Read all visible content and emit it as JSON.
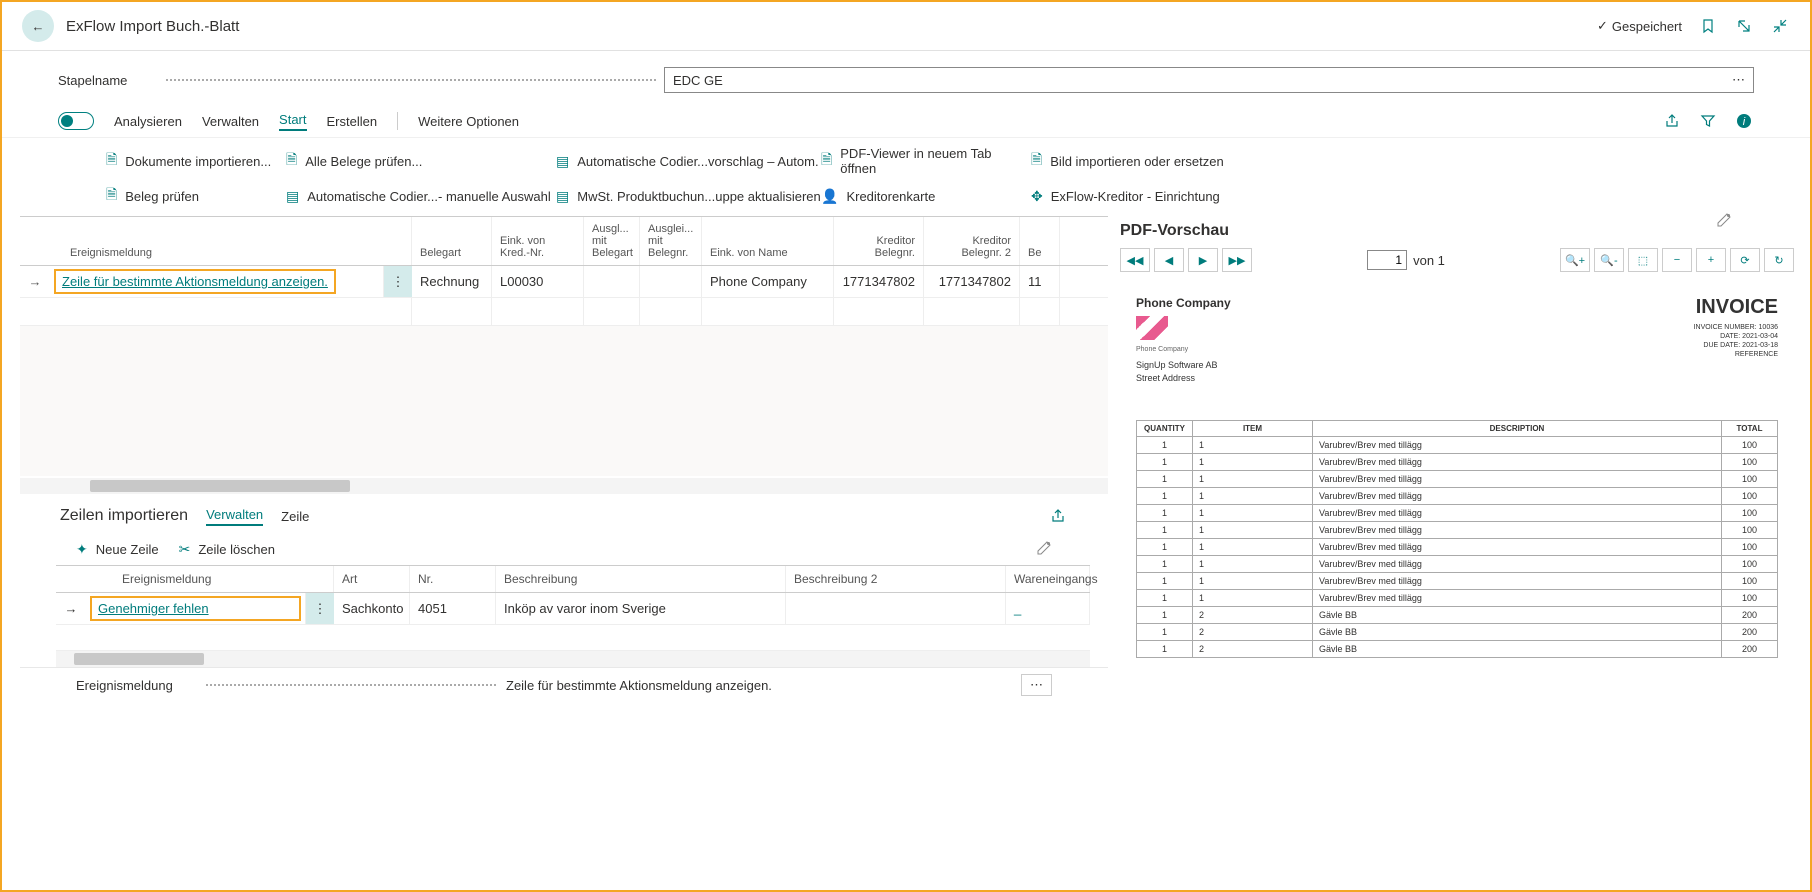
{
  "header": {
    "title": "ExFlow Import Buch.-Blatt",
    "saved": "Gespeichert"
  },
  "field": {
    "label": "Stapelname",
    "value": "EDC GE"
  },
  "toolbar": {
    "analyse": "Analysieren",
    "verwalten": "Verwalten",
    "start": "Start",
    "erstellen": "Erstellen",
    "weitere": "Weitere Optionen"
  },
  "actions": {
    "r1c1": "Dokumente importieren...",
    "r1c2": "Alle Belege prüfen...",
    "r1c3": "Automatische Codier...vorschlag – Autom.",
    "r1c4": "PDF-Viewer in neuem Tab öffnen",
    "r1c5": "Bild importieren oder ersetzen",
    "r2c1": "Beleg prüfen",
    "r2c2": "Automatische Codier...- manuelle Auswahl",
    "r2c3": "MwSt. Produktbuchun...uppe aktualisieren",
    "r2c4": "Kreditorenkarte",
    "r2c5": "ExFlow-Kreditor - Einrichtung"
  },
  "grid": {
    "headers": {
      "msg": "Ereignismeldung",
      "belegart": "Belegart",
      "eink": "Eink. von Kred.-Nr.",
      "ausgl1": "Ausgl... mit Belegart",
      "ausgl2": "Ausglei... mit Belegnr.",
      "einkname": "Eink. von Name",
      "kred1": "Kreditor Belegnr.",
      "kred2": "Kreditor Belegnr. 2",
      "be": "Be"
    },
    "row1": {
      "msg": "Zeile für bestimmte Aktionsmeldung anzeigen.",
      "belegart": "Rechnung",
      "eink": "L00030",
      "einkname": "Phone Company",
      "kred1": "1771347802",
      "kred2": "1771347802",
      "be": "11"
    }
  },
  "sub": {
    "title": "Zeilen importieren",
    "verwalten": "Verwalten",
    "zeile": "Zeile",
    "neue": "Neue Zeile",
    "loeschen": "Zeile löschen"
  },
  "grid2": {
    "headers": {
      "msg": "Ereignismeldung",
      "art": "Art",
      "nr": "Nr.",
      "besch": "Beschreibung",
      "besch2": "Beschreibung 2",
      "waren": "Wareneingangs"
    },
    "row1": {
      "msg": "Genehmiger fehlen",
      "art": "Sachkonto",
      "nr": "4051",
      "besch": "Inköp av varor inom Sverige",
      "waren": "_"
    }
  },
  "footer": {
    "label": "Ereignismeldung",
    "value": "Zeile für bestimmte Aktionsmeldung anzeigen."
  },
  "pdf": {
    "title": "PDF-Vorschau",
    "page": "1",
    "pageOf": "von 1",
    "company": "Phone Company",
    "logoText": "Phone Company",
    "address1": "SignUp Software AB",
    "address2": "Street Address",
    "invoiceLabel": "INVOICE",
    "meta1": "INVOICE NUMBER: 10036",
    "meta2": "DATE: 2021-03-04",
    "meta3": "DUE DATE: 2021-03-18",
    "meta4": "REFERENCE",
    "th_qty": "QUANTITY",
    "th_item": "ITEM",
    "th_desc": "DESCRIPTION",
    "th_total": "TOTAL",
    "rows": [
      {
        "q": "1",
        "i": "1",
        "d": "Varubrev/Brev med tillägg",
        "t": "100"
      },
      {
        "q": "1",
        "i": "1",
        "d": "Varubrev/Brev med tillägg",
        "t": "100"
      },
      {
        "q": "1",
        "i": "1",
        "d": "Varubrev/Brev med tillägg",
        "t": "100"
      },
      {
        "q": "1",
        "i": "1",
        "d": "Varubrev/Brev med tillägg",
        "t": "100"
      },
      {
        "q": "1",
        "i": "1",
        "d": "Varubrev/Brev med tillägg",
        "t": "100"
      },
      {
        "q": "1",
        "i": "1",
        "d": "Varubrev/Brev med tillägg",
        "t": "100"
      },
      {
        "q": "1",
        "i": "1",
        "d": "Varubrev/Brev med tillägg",
        "t": "100"
      },
      {
        "q": "1",
        "i": "1",
        "d": "Varubrev/Brev med tillägg",
        "t": "100"
      },
      {
        "q": "1",
        "i": "1",
        "d": "Varubrev/Brev med tillägg",
        "t": "100"
      },
      {
        "q": "1",
        "i": "1",
        "d": "Varubrev/Brev med tillägg",
        "t": "100"
      },
      {
        "q": "1",
        "i": "2",
        "d": "Gävle BB",
        "t": "200"
      },
      {
        "q": "1",
        "i": "2",
        "d": "Gävle BB",
        "t": "200"
      },
      {
        "q": "1",
        "i": "2",
        "d": "Gävle BB",
        "t": "200"
      }
    ]
  }
}
